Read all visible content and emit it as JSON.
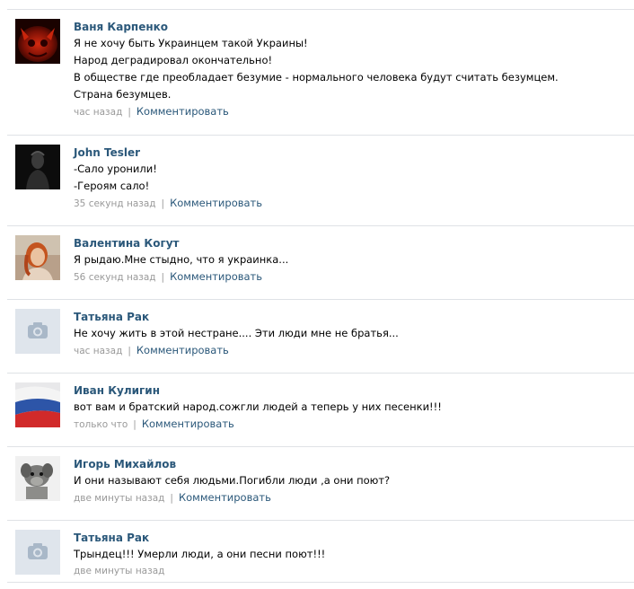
{
  "comments": [
    {
      "author": "Ваня Карпенко",
      "avatar_icon": "red-devil-avatar",
      "lines": [
        "Я не хочу быть Украинцем такой Украины!",
        "Народ деградировал окончательно!",
        "В обществе где преобладает безумие - нормального человека будут считать безумцем.",
        "Страна безумцев."
      ],
      "time": "час назад",
      "reply_label": "Комментировать"
    },
    {
      "author": "John Tesler",
      "avatar_icon": "dark-figure-avatar",
      "lines": [
        "-Сало уронили!",
        "-Героям сало!"
      ],
      "time": "35 секунд назад",
      "reply_label": "Комментировать"
    },
    {
      "author": "Валентина Когут",
      "avatar_icon": "woman-photo-avatar",
      "lines": [
        "Я рыдаю.Мне стыдно, что я украинка..."
      ],
      "time": "56 секунд назад",
      "reply_label": "Комментировать"
    },
    {
      "author": "Татьяна Рак",
      "avatar_icon": "camera-placeholder-icon",
      "lines": [
        "Не хочу жить в этой нестране.... Эти люди мне не братья..."
      ],
      "time": "час назад",
      "reply_label": "Комментировать"
    },
    {
      "author": "Иван Кулигин",
      "avatar_icon": "russian-flag-avatar",
      "lines": [
        "вот вам и братский народ.сожгли людей а теперь у них песенки!!!"
      ],
      "time": "только что",
      "reply_label": "Комментировать"
    },
    {
      "author": "Игорь Михайлов",
      "avatar_icon": "animal-photo-avatar",
      "lines": [
        "И они называют себя людьми.Погибли люди ,а они поют?"
      ],
      "time": "две минуты назад",
      "reply_label": "Комментировать"
    },
    {
      "author": "Татьяна Рак",
      "avatar_icon": "camera-placeholder-icon",
      "lines": [
        "Трындец!!! Умерли люди, а они песни поют!!!"
      ],
      "time": "две минуты назад",
      "reply_label": ""
    }
  ],
  "colors": {
    "author": "#2b587a",
    "meta": "#999999",
    "divider": "#dfe2e6",
    "placeholder_bg": "#dfe5ec",
    "placeholder_icon": "#9fb0c2"
  }
}
